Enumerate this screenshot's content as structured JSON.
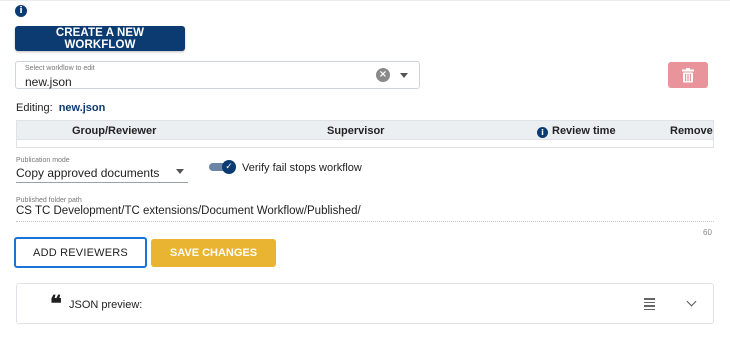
{
  "header": {
    "create_button": "CREATE A NEW WORKFLOW"
  },
  "workflow_select": {
    "label": "Select workflow to edit",
    "value": "new.json"
  },
  "editing": {
    "label": "Editing:",
    "filename": "new.json"
  },
  "table": {
    "columns": [
      "Group/Reviewer",
      "Supervisor",
      "Review time",
      "Remove"
    ]
  },
  "publication_mode": {
    "label": "Publication mode",
    "value": "Copy approved documents"
  },
  "verify_toggle": {
    "label": "Verify fail stops workflow",
    "checked": true
  },
  "published_folder": {
    "label": "Published folder path",
    "value": "CS TC Development/TC extensions/Document Workflow/Published/",
    "counter": "60"
  },
  "actions": {
    "add_reviewers": "ADD REVIEWERS",
    "save_changes": "SAVE CHANGES"
  },
  "json_preview": {
    "label": "JSON preview:"
  },
  "colors": {
    "primary": "#0b3b70",
    "save": "#e8b431",
    "delete": "#e8949a",
    "focus": "#1a73d9"
  },
  "icons": [
    "info-icon",
    "clear-icon",
    "chevron-down-icon",
    "trash-icon",
    "check-icon",
    "quote-icon",
    "lines-icon"
  ]
}
